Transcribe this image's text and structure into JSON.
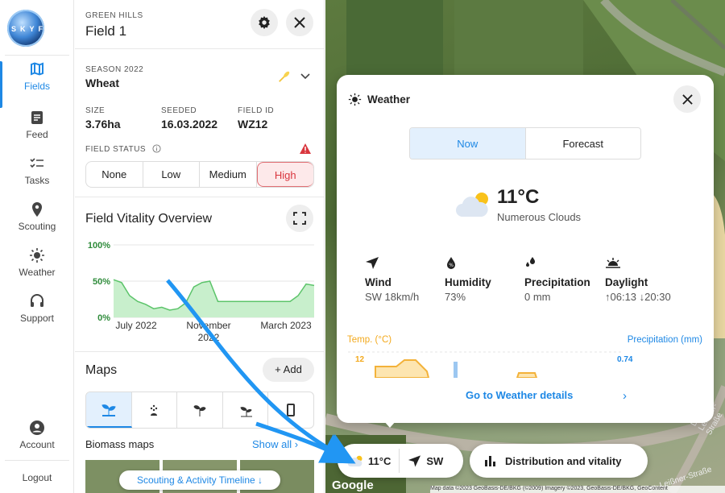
{
  "app": {
    "logo_text": "SKYFLD"
  },
  "nav": {
    "items": [
      {
        "label": "Fields",
        "icon": "map-icon",
        "active": true
      },
      {
        "label": "Feed",
        "icon": "feed-icon"
      },
      {
        "label": "Tasks",
        "icon": "tasks-icon"
      },
      {
        "label": "Scouting",
        "icon": "location-pin-icon"
      },
      {
        "label": "Weather",
        "icon": "sun-icon"
      },
      {
        "label": "Support",
        "icon": "headset-icon"
      }
    ],
    "account": "Account",
    "logout": "Logout"
  },
  "field": {
    "farm": "GREEN HILLS",
    "name": "Field 1",
    "season_label": "SEASON 2022",
    "crop": "Wheat",
    "size_label": "SIZE",
    "size": "3.76ha",
    "seeded_label": "SEEDED",
    "seeded": "16.03.2022",
    "id_label": "FIELD ID",
    "id": "WZ12",
    "status_label": "FIELD STATUS",
    "status_options": [
      "None",
      "Low",
      "Medium",
      "High"
    ],
    "status_selected": "High"
  },
  "vitality": {
    "title": "Field Vitality Overview"
  },
  "chart_data": {
    "type": "area",
    "title": "Field Vitality Overview",
    "yticks": [
      "100%",
      "50%",
      "0%"
    ],
    "xticks": [
      "July 2022",
      "November 2022",
      "March 2023"
    ],
    "ylim": [
      0,
      100
    ],
    "x": [
      0,
      4,
      8,
      12,
      16,
      20,
      24,
      28,
      32,
      36,
      40,
      44,
      48,
      52,
      56,
      60,
      64,
      68,
      72,
      76,
      80,
      84,
      88,
      92,
      96,
      100
    ],
    "values": [
      52,
      48,
      30,
      22,
      18,
      12,
      14,
      10,
      12,
      20,
      42,
      48,
      50,
      22,
      22,
      22,
      22,
      22,
      22,
      22,
      22,
      22,
      22,
      30,
      46,
      44
    ],
    "color": "#5cc46a"
  },
  "maps": {
    "title": "Maps",
    "add_label": "Add",
    "biomass_label": "Biomass maps",
    "show_all": "Show all",
    "timeline_label": "Scouting & Activity Timeline"
  },
  "weather": {
    "title": "Weather",
    "tab_now": "Now",
    "tab_forecast": "Forecast",
    "temp": "11°C",
    "condition": "Numerous Clouds",
    "wind_label": "Wind",
    "wind_value": "SW 18km/h",
    "humidity_label": "Humidity",
    "humidity_value": "73%",
    "precip_label": "Precipitation",
    "precip_value": "0 mm",
    "daylight_label": "Daylight",
    "daylight_value": "↑06:13 ↓20:30",
    "temp_axis_label": "Temp. (°C)",
    "temp_max": "12",
    "precip_axis_label": "Precipitation (mm)",
    "precip_max": "0.74",
    "details_link": "Go to Weather details",
    "accent": "#1e88e5"
  },
  "map_bar": {
    "temp": "11°C",
    "wind_dir": "SW",
    "distribution": "Distribution and vitality",
    "google": "Google",
    "attribution": "Map data ©2023 GeoBasis-DE/BKG (©2009) Imagery ©2023, GeoBasis-DE/BKG, GeoContent",
    "road_label": "Dr.-Leißner-Straße"
  },
  "colors": {
    "accent": "#1e88e5",
    "high": "#d9363e",
    "vitality": "#5cc46a",
    "temp": "#f3b23a"
  }
}
